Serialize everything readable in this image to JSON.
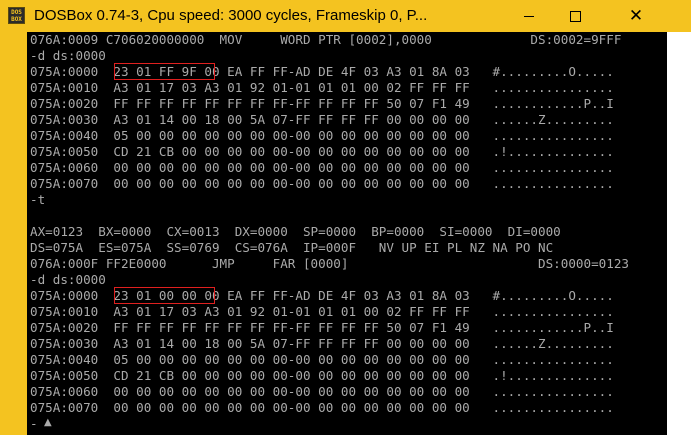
{
  "window": {
    "title": "DOSBox 0.74-3, Cpu speed:     3000 cycles, Frameskip  0, P...",
    "icon_label": "DOS BOX",
    "icons": {
      "app": "dosbox-icon",
      "minimize": "minimize-icon",
      "maximize": "maximize-icon",
      "close": "close-icon"
    },
    "close_glyph": "✕"
  },
  "colors": {
    "titlebar": "#f4c320",
    "screen_bg": "#000000",
    "text": "#aaaaaa",
    "highlight_box": "#e0201f"
  },
  "terminal": {
    "lines": [
      "076A:0009 C706020000000  MOV     WORD PTR [0002],0000             DS:0002=9FFF",
      "-d ds:0000",
      "075A:0000  23 01 FF 9F 00 EA FF FF-AD DE 4F 03 A3 01 8A 03   #.........O.....",
      "075A:0010  A3 01 17 03 A3 01 92 01-01 01 01 00 02 FF FF FF   ................",
      "075A:0020  FF FF FF FF FF FF FF FF-FF FF FF FF 50 07 F1 49   ............P..I",
      "075A:0030  A3 01 14 00 18 00 5A 07-FF FF FF FF 00 00 00 00   ......Z.........",
      "075A:0040  05 00 00 00 00 00 00 00-00 00 00 00 00 00 00 00   ................",
      "075A:0050  CD 21 CB 00 00 00 00 00-00 00 00 00 00 00 00 00   .!..............",
      "075A:0060  00 00 00 00 00 00 00 00-00 00 00 00 00 00 00 00   ................",
      "075A:0070  00 00 00 00 00 00 00 00-00 00 00 00 00 00 00 00   ................",
      "-t",
      "",
      "AX=0123  BX=0000  CX=0013  DX=0000  SP=0000  BP=0000  SI=0000  DI=0000",
      "DS=075A  ES=075A  SS=0769  CS=076A  IP=000F   NV UP EI PL NZ NA PO NC",
      "076A:000F FF2E0000      JMP     FAR [0000]                         DS:0000=0123",
      "-d ds:0000",
      "075A:0000  23 01 00 00 00 EA FF FF-AD DE 4F 03 A3 01 8A 03   #.........O.....",
      "075A:0010  A3 01 17 03 A3 01 92 01-01 01 01 00 02 FF FF FF   ................",
      "075A:0020  FF FF FF FF FF FF FF FF-FF FF FF FF 50 07 F1 49   ............P..I",
      "075A:0030  A3 01 14 00 18 00 5A 07-FF FF FF FF 00 00 00 00   ......Z.........",
      "075A:0040  05 00 00 00 00 00 00 00-00 00 00 00 00 00 00 00   ................",
      "075A:0050  CD 21 CB 00 00 00 00 00-00 00 00 00 00 00 00 00   .!..............",
      "075A:0060  00 00 00 00 00 00 00 00-00 00 00 00 00 00 00 00   ................",
      "075A:0070  00 00 00 00 00 00 00 00-00 00 00 00 00 00 00 00   ................",
      "-"
    ]
  },
  "bottom_glyph": "▲"
}
